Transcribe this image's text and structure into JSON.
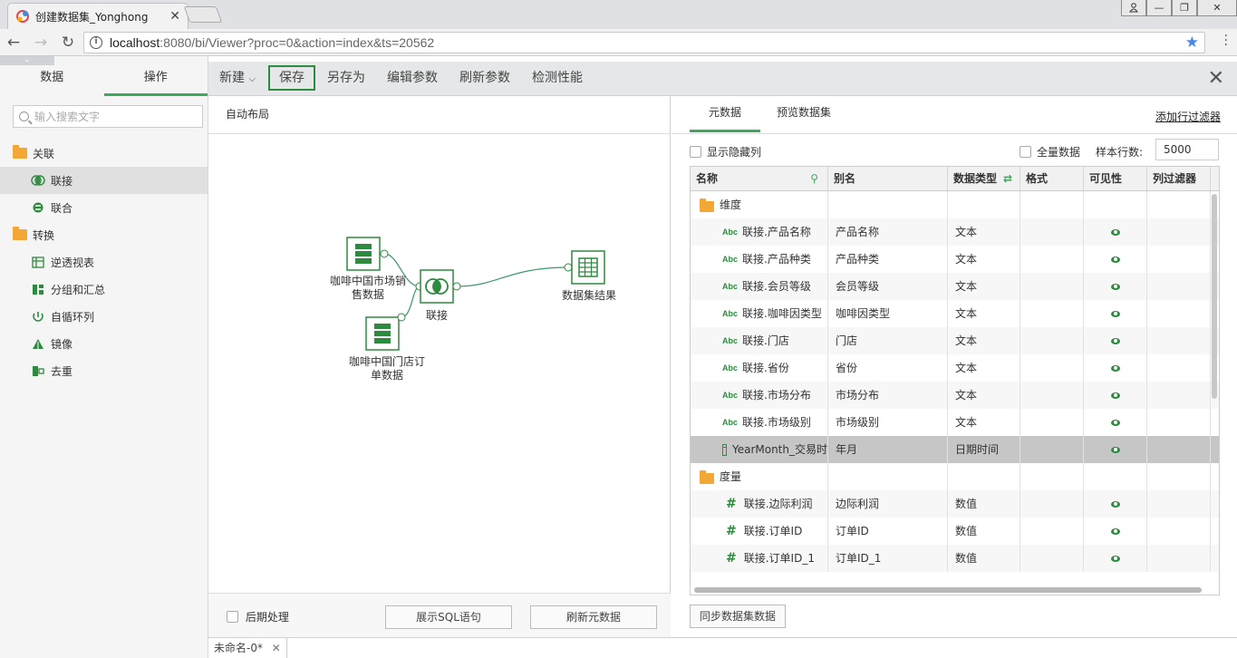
{
  "browser": {
    "tab_title": "创建数据集_Yonghong",
    "url_host": "localhost",
    "url_rest": ":8080/bi/Viewer?proc=0&action=index&ts=20562"
  },
  "left": {
    "tabs": [
      "数据",
      "操作"
    ],
    "active_tab": 1,
    "search_placeholder": "输入搜索文字",
    "groups": [
      {
        "label": "关联",
        "items": [
          {
            "label": "联接",
            "icon": "join-icon"
          },
          {
            "label": "联合",
            "icon": "union-icon"
          }
        ]
      },
      {
        "label": "转换",
        "items": [
          {
            "label": "逆透视表",
            "icon": "unpivot-icon"
          },
          {
            "label": "分组和汇总",
            "icon": "group-summary-icon"
          },
          {
            "label": "自循环列",
            "icon": "self-loop-icon"
          },
          {
            "label": "镜像",
            "icon": "mirror-icon"
          },
          {
            "label": "去重",
            "icon": "dedupe-icon"
          }
        ]
      }
    ]
  },
  "toolbar": {
    "new_label": "新建",
    "save_label": "保存",
    "save_as_label": "另存为",
    "edit_params_label": "编辑参数",
    "refresh_params_label": "刷新参数",
    "check_perf_label": "检测性能"
  },
  "center": {
    "auto_layout_label": "自动布局",
    "nodes": {
      "n1": "咖啡中国市场销售数据",
      "n1a": "咖啡中国市场销",
      "n1b": "售数据",
      "n2a": "咖啡中国门店订",
      "n2b": "单数据",
      "join": "联接",
      "result": "数据集结果"
    },
    "post_process_label": "后期处理",
    "show_sql_label": "展示SQL语句",
    "refresh_meta_label": "刷新元数据"
  },
  "right": {
    "tabs": [
      "元数据",
      "预览数据集"
    ],
    "add_row_filter_label": "添加行过滤器",
    "show_hidden_label": "显示隐藏列",
    "full_data_label": "全量数据",
    "sample_rows_label": "样本行数:",
    "sample_rows_value": "5000",
    "columns": [
      "名称",
      "别名",
      "数据类型",
      "格式",
      "可见性",
      "列过滤器"
    ],
    "rows": [
      {
        "kind": "group",
        "name": "维度"
      },
      {
        "kind": "text",
        "name": "联接.产品名称",
        "alias": "产品名称",
        "type": "文本"
      },
      {
        "kind": "text",
        "name": "联接.产品种类",
        "alias": "产品种类",
        "type": "文本"
      },
      {
        "kind": "text",
        "name": "联接.会员等级",
        "alias": "会员等级",
        "type": "文本"
      },
      {
        "kind": "text",
        "name": "联接.咖啡因类型",
        "alias": "咖啡因类型",
        "type": "文本"
      },
      {
        "kind": "text",
        "name": "联接.门店",
        "alias": "门店",
        "type": "文本"
      },
      {
        "kind": "text",
        "name": "联接.省份",
        "alias": "省份",
        "type": "文本"
      },
      {
        "kind": "text",
        "name": "联接.市场分布",
        "alias": "市场分布",
        "type": "文本"
      },
      {
        "kind": "text",
        "name": "联接.市场级别",
        "alias": "市场级别",
        "type": "文本"
      },
      {
        "kind": "date",
        "name": "YearMonth_交易时",
        "alias": "年月",
        "type": "日期时间",
        "selected": true
      },
      {
        "kind": "group",
        "name": "度量"
      },
      {
        "kind": "num",
        "name": "联接.边际利润",
        "alias": "边际利润",
        "type": "数值"
      },
      {
        "kind": "num",
        "name": "联接.订单ID",
        "alias": "订单ID",
        "type": "数值"
      },
      {
        "kind": "num",
        "name": "联接.订单ID_1",
        "alias": "订单ID_1",
        "type": "数值"
      }
    ],
    "sync_label": "同步数据集数据"
  },
  "bottom": {
    "tab_label": "未命名-0*"
  },
  "colors": {
    "accent": "#3daa5b",
    "save_border": "#2e8a3e",
    "icon_green": "#2e8a3e",
    "folder": "#f3a735"
  }
}
